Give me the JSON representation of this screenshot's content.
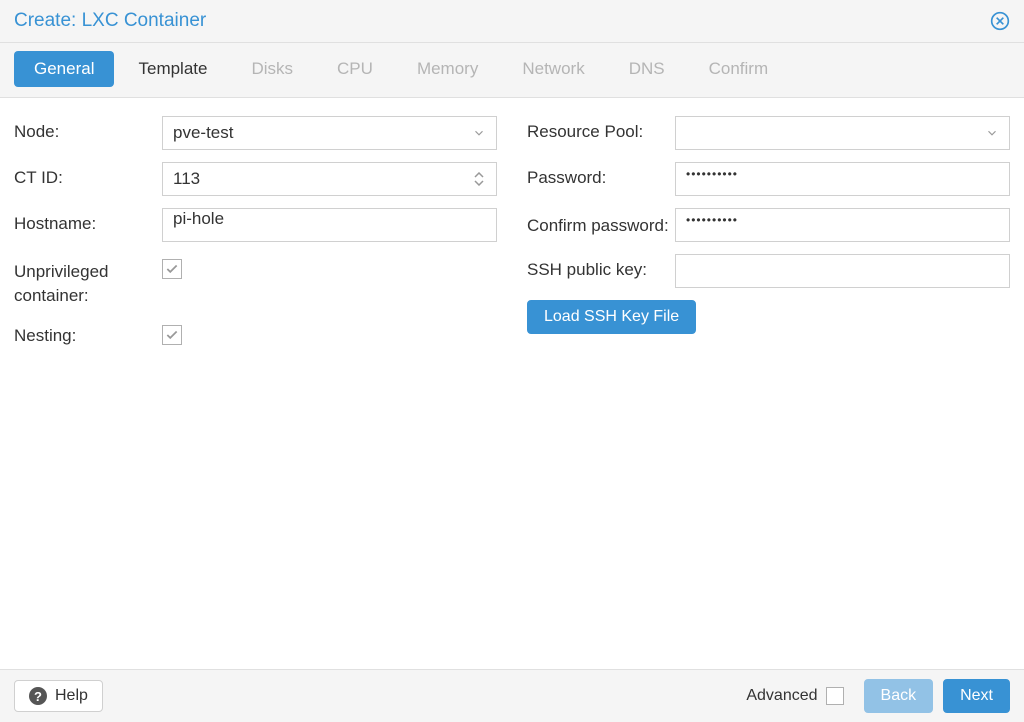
{
  "dialog": {
    "title": "Create: LXC Container"
  },
  "tabs": [
    {
      "label": "General",
      "state": "active"
    },
    {
      "label": "Template",
      "state": "current"
    },
    {
      "label": "Disks",
      "state": "disabled"
    },
    {
      "label": "CPU",
      "state": "disabled"
    },
    {
      "label": "Memory",
      "state": "disabled"
    },
    {
      "label": "Network",
      "state": "disabled"
    },
    {
      "label": "DNS",
      "state": "disabled"
    },
    {
      "label": "Confirm",
      "state": "disabled"
    }
  ],
  "form": {
    "left": {
      "node": {
        "label": "Node:",
        "value": "pve-test"
      },
      "ctid": {
        "label": "CT ID:",
        "value": "113"
      },
      "hostname": {
        "label": "Hostname:",
        "value": "pi-hole"
      },
      "unprivileged": {
        "label": "Unprivileged container:",
        "checked": true
      },
      "nesting": {
        "label": "Nesting:",
        "checked": true
      }
    },
    "right": {
      "pool": {
        "label": "Resource Pool:",
        "value": ""
      },
      "password": {
        "label": "Password:",
        "value": "••••••••••"
      },
      "confirm_password": {
        "label": "Confirm password:",
        "value": "••••••••••"
      },
      "ssh_key": {
        "label": "SSH public key:",
        "value": ""
      },
      "load_ssh": {
        "label": "Load SSH Key File"
      }
    }
  },
  "footer": {
    "help": "Help",
    "advanced": "Advanced",
    "back": "Back",
    "next": "Next"
  }
}
